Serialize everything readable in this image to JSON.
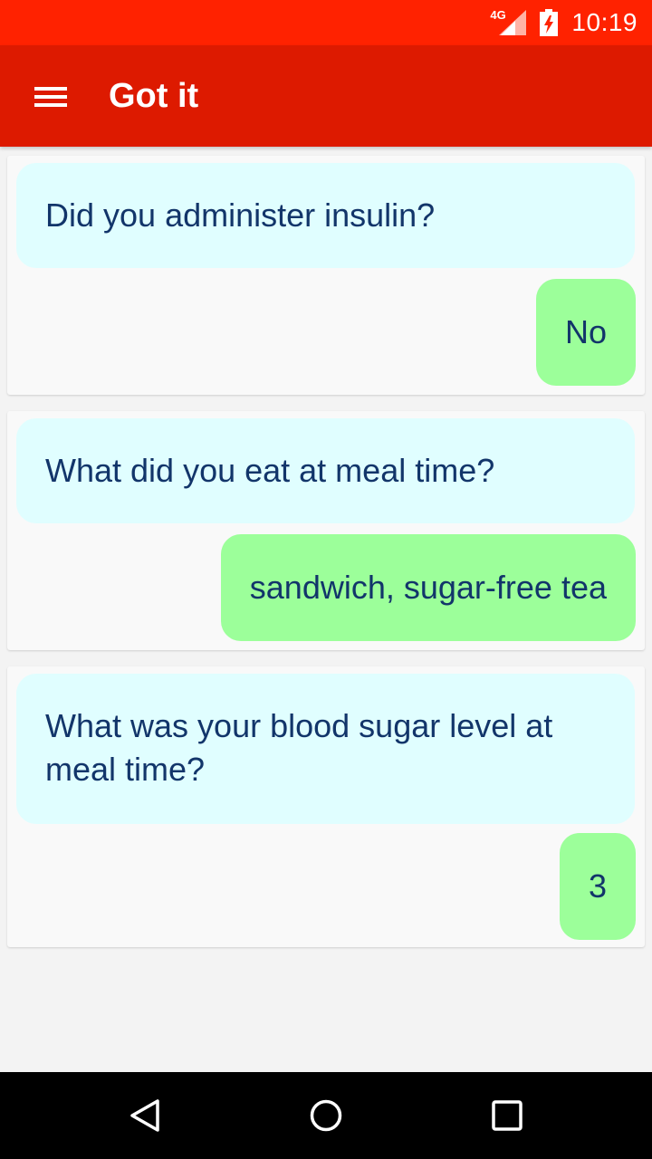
{
  "status_bar": {
    "network": "4G",
    "time": "10:19",
    "icons": [
      "signal-icon",
      "battery-charging-icon"
    ]
  },
  "app_bar": {
    "title": "Got it",
    "menu_icon": "menu-icon"
  },
  "conversation": [
    {
      "question": "Did you administer insulin?",
      "answer": "No"
    },
    {
      "question": "What did you eat at meal time?",
      "answer": "sandwich, sugar-free tea"
    },
    {
      "question": "What was your blood sugar level at meal time?",
      "answer": "3"
    }
  ],
  "nav_bar": {
    "icons": [
      "back-icon",
      "home-icon",
      "recents-icon"
    ]
  },
  "colors": {
    "status_bar": "#ff2200",
    "app_bar": "#dd1a00",
    "question_bubble": "#e0feff",
    "answer_bubble": "#9cff9a",
    "text": "#12356a"
  }
}
